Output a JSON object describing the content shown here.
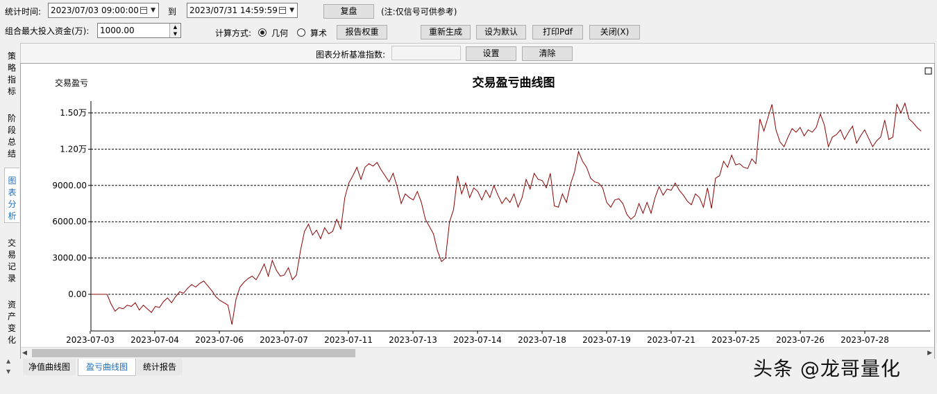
{
  "toolbar": {
    "time_label": "统计时间:",
    "start_time": "2023/07/03 09:00:00",
    "to_label": "到",
    "end_time": "2023/07/31 14:59:59",
    "replay_button": "复盘",
    "note": "(注:仅信号可供参考)",
    "capital_label": "组合最大投入资金(万):",
    "capital_value": "1000.00",
    "calc_label": "计算方式:",
    "calc_geometric": "几何",
    "calc_arithmetic": "算术",
    "report_weight_button": "报告权重",
    "regenerate_button": "重新生成",
    "set_default_button": "设为默认",
    "print_pdf_button": "打印Pdf",
    "close_button": "关闭(X)"
  },
  "benchmark": {
    "label": "图表分析基准指数:",
    "value": "",
    "set_button": "设置",
    "clear_button": "清除"
  },
  "side_tabs": [
    {
      "label": "策略指标",
      "chars": [
        "策",
        "略",
        "指",
        "标"
      ]
    },
    {
      "label": "阶段总结",
      "chars": [
        "阶",
        "段",
        "总",
        "结"
      ]
    },
    {
      "label": "图表分析",
      "chars": [
        "图",
        "表",
        "分",
        "析"
      ]
    },
    {
      "label": "交易记录",
      "chars": [
        "交",
        "易",
        "记",
        "录"
      ]
    },
    {
      "label": "资产变化",
      "chars": [
        "资",
        "产",
        "变",
        "化"
      ]
    }
  ],
  "bottom_tabs": [
    "净值曲线图",
    "盈亏曲线图",
    "统计报告"
  ],
  "watermark": "头条 @龙哥量化",
  "chart_data": {
    "type": "line",
    "title": "交易盈亏曲线图",
    "ylabel": "交易盈亏",
    "xlabel": "",
    "y_tick_labels": [
      "0.00",
      "3000.00",
      "6000.00",
      "9000.00",
      "1.20万",
      "1.50万"
    ],
    "y_tick_values": [
      0,
      3000,
      6000,
      9000,
      12000,
      15000
    ],
    "ylim": [
      -3000,
      16500
    ],
    "x_tick_labels": [
      "2023-07-03",
      "2023-07-04",
      "2023-07-06",
      "2023-07-07",
      "2023-07-11",
      "2023-07-13",
      "2023-07-14",
      "2023-07-18",
      "2023-07-19",
      "2023-07-21",
      "2023-07-25",
      "2023-07-26",
      "2023-07-28"
    ],
    "grid": "horizontal dashed",
    "line_color": "#8b0000",
    "series": [
      {
        "values": [
          0,
          0,
          0,
          0,
          0,
          -800,
          -1400,
          -1100,
          -1200,
          -900,
          -1000,
          -700,
          -1300,
          -900,
          -1200,
          -1500,
          -1000,
          -1100,
          -600,
          -300,
          -700,
          -200,
          200,
          100,
          500,
          800,
          600,
          900,
          1100,
          700,
          300,
          -200,
          -500,
          -700,
          -900,
          -2500,
          -400,
          600,
          1000,
          1300,
          1500,
          1200,
          1800,
          2500,
          1500,
          2800,
          2000,
          1500,
          1600,
          2200,
          1200,
          1600,
          3600,
          5200,
          5800,
          4900,
          5300,
          4600,
          5500,
          5000,
          5200,
          6200,
          5400,
          8000,
          9200,
          9800,
          10500,
          9500,
          10500,
          10800,
          10600,
          10900,
          10300,
          9800,
          9300,
          10000,
          8900,
          7500,
          8300,
          8000,
          7800,
          8500,
          7600,
          6200,
          5600,
          5000,
          3600,
          2700,
          3000,
          6000,
          7000,
          9800,
          8300,
          9200,
          8000,
          8800,
          8500,
          7800,
          8600,
          8000,
          9000,
          8200,
          7500,
          8000,
          7600,
          8300,
          7200,
          8000,
          9500,
          8700,
          10000,
          9500,
          9400,
          8800,
          10000,
          7300,
          7200,
          8300,
          7600,
          9100,
          10100,
          11800,
          11000,
          10500,
          9600,
          9300,
          9200,
          8800,
          7600,
          7200,
          7800,
          7900,
          7500,
          6600,
          6200,
          6500,
          7500,
          6700,
          7600,
          6700,
          8000,
          8900,
          8200,
          8700,
          8600,
          9200,
          8600,
          8200,
          7700,
          7400,
          8300,
          8000,
          7200,
          8800,
          7100,
          9600,
          9800,
          11000,
          10500,
          11500,
          10700,
          10800,
          10500,
          10400,
          11200,
          10800,
          14500,
          13500,
          14600,
          15700,
          13600,
          12600,
          12200,
          13000,
          13700,
          13400,
          13800,
          13100,
          13600,
          13400,
          13800,
          14900,
          14000,
          12200,
          13000,
          13200,
          13600,
          12800,
          13400,
          13900,
          12500,
          13100,
          13600,
          12900,
          12200,
          12700,
          13000,
          14400,
          12800,
          13000,
          15700,
          15000,
          15800,
          14500,
          14200,
          13800,
          13500
        ]
      }
    ]
  }
}
